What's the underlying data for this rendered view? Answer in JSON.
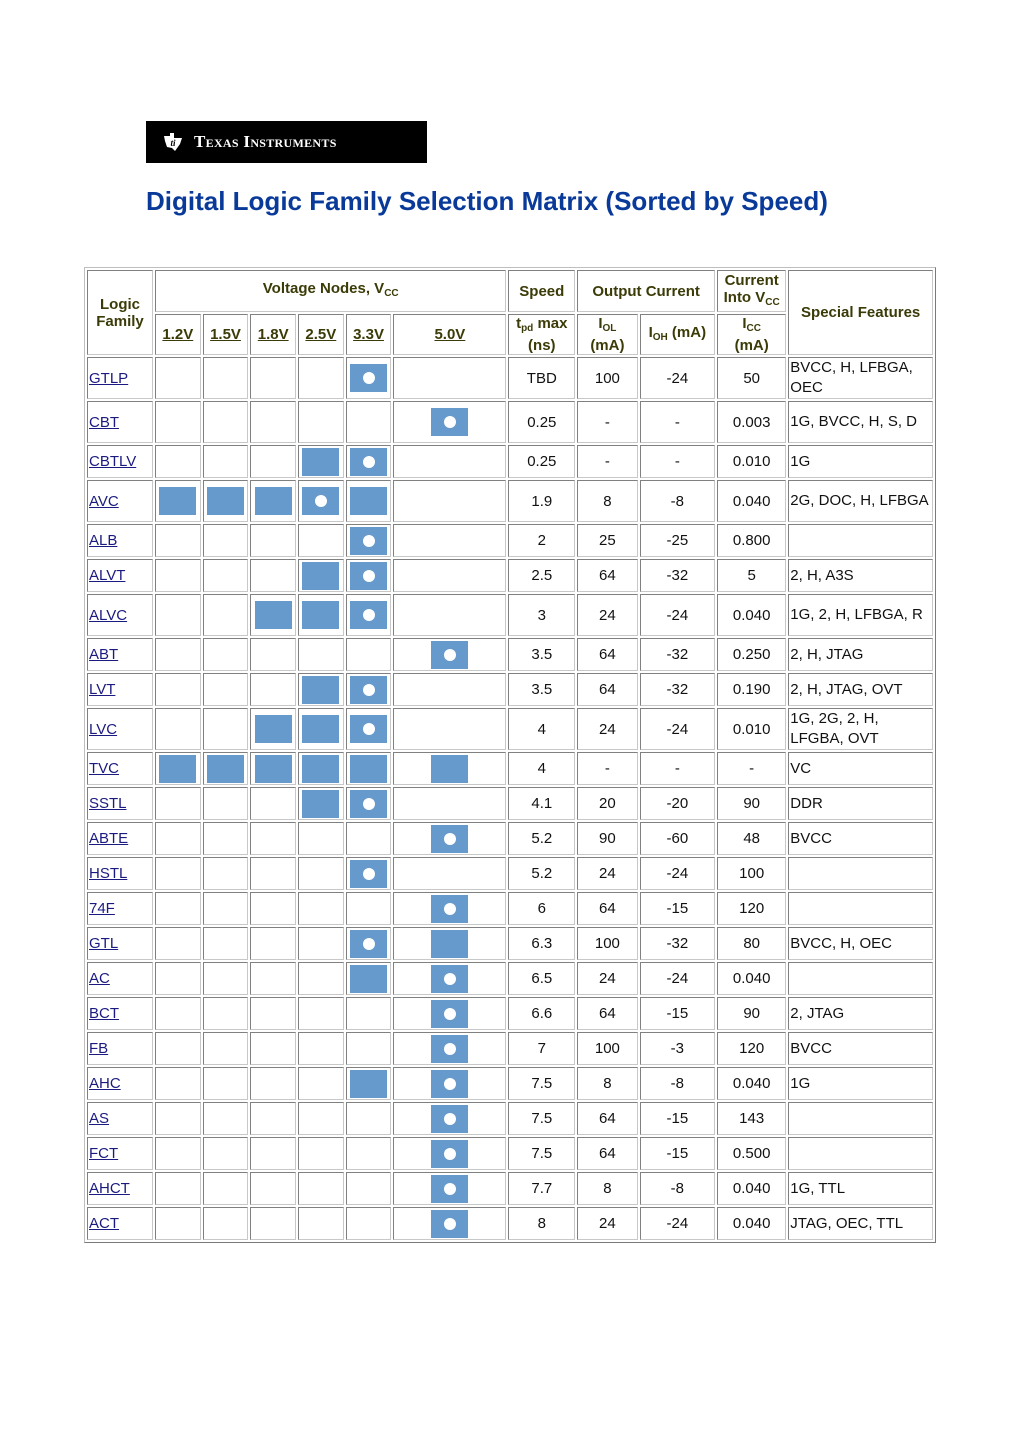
{
  "logo": {
    "brand": "Texas Instruments",
    "icon": "ti-state-logo-icon"
  },
  "page_title": "Digital Logic Family Selection Matrix (Sorted by Speed)",
  "table": {
    "headers": {
      "logic_family": "Logic Family",
      "voltage_nodes": "Voltage Nodes, V",
      "voltage_nodes_sub": "CC",
      "speed": "Speed",
      "output_current": "Output Current",
      "current_into": "Current Into V",
      "current_into_sub": "CC",
      "special_features": "Special Features",
      "voltages": [
        "1.2V",
        "1.5V",
        "1.8V",
        "2.5V",
        "3.3V",
        "5.0V"
      ],
      "tpd_main": "t",
      "tpd_sub": "pd",
      "tpd_rest": " max (ns)",
      "iol_main": "I",
      "iol_sub": "OL",
      "iol_rest": "(mA)",
      "ioh_main": "I",
      "ioh_sub": "OH",
      "ioh_rest": " (mA)",
      "icc_main": "I",
      "icc_sub": "CC",
      "icc_rest": "(mA)"
    },
    "legend": {
      "supported": "filled-blue-cell",
      "optimized": "blue-cell-with-white-dot",
      "color": "#6699cc"
    },
    "rows": [
      {
        "family": "GTLP",
        "v": [
          "",
          "",
          "",
          "",
          "opt",
          ""
        ],
        "tpd": "TBD",
        "iol": "100",
        "ioh": "-24",
        "icc": "50",
        "features": "BVCC, H, LFBGA, OEC",
        "tall": true
      },
      {
        "family": "CBT",
        "v": [
          "",
          "",
          "",
          "",
          "",
          "opt"
        ],
        "tpd": "0.25",
        "iol": "-",
        "ioh": "-",
        "icc": "0.003",
        "features": "1G, BVCC, H, S, D",
        "tall": true
      },
      {
        "family": "CBTLV",
        "v": [
          "",
          "",
          "",
          "sup",
          "opt",
          ""
        ],
        "tpd": "0.25",
        "iol": "-",
        "ioh": "-",
        "icc": "0.010",
        "features": "1G"
      },
      {
        "family": "AVC",
        "v": [
          "sup",
          "sup",
          "sup",
          "opt",
          "sup",
          ""
        ],
        "tpd": "1.9",
        "iol": "8",
        "ioh": "-8",
        "icc": "0.040",
        "features": "2G, DOC, H, LFBGA",
        "tall": true
      },
      {
        "family": "ALB",
        "v": [
          "",
          "",
          "",
          "",
          "opt",
          ""
        ],
        "tpd": "2",
        "iol": "25",
        "ioh": "-25",
        "icc": "0.800",
        "features": ""
      },
      {
        "family": "ALVT",
        "v": [
          "",
          "",
          "",
          "sup",
          "opt",
          ""
        ],
        "tpd": "2.5",
        "iol": "64",
        "ioh": "-32",
        "icc": "5",
        "features": "2, H, A3S"
      },
      {
        "family": "ALVC",
        "v": [
          "",
          "",
          "sup",
          "sup",
          "opt",
          ""
        ],
        "tpd": "3",
        "iol": "24",
        "ioh": "-24",
        "icc": "0.040",
        "features": "1G, 2, H, LFBGA, R",
        "tall": true
      },
      {
        "family": "ABT",
        "v": [
          "",
          "",
          "",
          "",
          "",
          "opt"
        ],
        "tpd": "3.5",
        "iol": "64",
        "ioh": "-32",
        "icc": "0.250",
        "features": "2, H, JTAG"
      },
      {
        "family": "LVT",
        "v": [
          "",
          "",
          "",
          "sup",
          "opt",
          ""
        ],
        "tpd": "3.5",
        "iol": "64",
        "ioh": "-32",
        "icc": "0.190",
        "features": "2, H, JTAG, OVT"
      },
      {
        "family": "LVC",
        "v": [
          "",
          "",
          "sup",
          "sup",
          "opt",
          ""
        ],
        "tpd": "4",
        "iol": "24",
        "ioh": "-24",
        "icc": "0.010",
        "features": "1G, 2G, 2, H, LFGBA, OVT",
        "tall": true
      },
      {
        "family": "TVC",
        "v": [
          "sup",
          "sup",
          "sup",
          "sup",
          "sup",
          "sup"
        ],
        "tpd": "4",
        "iol": "-",
        "ioh": "-",
        "icc": "-",
        "features": "VC"
      },
      {
        "family": "SSTL",
        "v": [
          "",
          "",
          "",
          "sup",
          "opt",
          ""
        ],
        "tpd": "4.1",
        "iol": "20",
        "ioh": "-20",
        "icc": "90",
        "features": "DDR"
      },
      {
        "family": "ABTE",
        "v": [
          "",
          "",
          "",
          "",
          "",
          "opt"
        ],
        "tpd": "5.2",
        "iol": "90",
        "ioh": "-60",
        "icc": "48",
        "features": "BVCC"
      },
      {
        "family": "HSTL",
        "v": [
          "",
          "",
          "",
          "",
          "opt",
          ""
        ],
        "tpd": "5.2",
        "iol": "24",
        "ioh": "-24",
        "icc": "100",
        "features": ""
      },
      {
        "family": "74F",
        "v": [
          "",
          "",
          "",
          "",
          "",
          "opt"
        ],
        "tpd": "6",
        "iol": "64",
        "ioh": "-15",
        "icc": "120",
        "features": ""
      },
      {
        "family": "GTL",
        "v": [
          "",
          "",
          "",
          "",
          "opt",
          "sup"
        ],
        "tpd": "6.3",
        "iol": "100",
        "ioh": "-32",
        "icc": "80",
        "features": "BVCC, H, OEC"
      },
      {
        "family": "AC",
        "v": [
          "",
          "",
          "",
          "",
          "sup",
          "opt"
        ],
        "tpd": "6.5",
        "iol": "24",
        "ioh": "-24",
        "icc": "0.040",
        "features": ""
      },
      {
        "family": "BCT",
        "v": [
          "",
          "",
          "",
          "",
          "",
          "opt"
        ],
        "tpd": "6.6",
        "iol": "64",
        "ioh": "-15",
        "icc": "90",
        "features": "2, JTAG"
      },
      {
        "family": "FB",
        "v": [
          "",
          "",
          "",
          "",
          "",
          "opt"
        ],
        "tpd": "7",
        "iol": "100",
        "ioh": "-3",
        "icc": "120",
        "features": "BVCC"
      },
      {
        "family": "AHC",
        "v": [
          "",
          "",
          "",
          "",
          "sup",
          "opt"
        ],
        "tpd": "7.5",
        "iol": "8",
        "ioh": "-8",
        "icc": "0.040",
        "features": "1G"
      },
      {
        "family": "AS",
        "v": [
          "",
          "",
          "",
          "",
          "",
          "opt"
        ],
        "tpd": "7.5",
        "iol": "64",
        "ioh": "-15",
        "icc": "143",
        "features": ""
      },
      {
        "family": "FCT",
        "v": [
          "",
          "",
          "",
          "",
          "",
          "opt"
        ],
        "tpd": "7.5",
        "iol": "64",
        "ioh": "-15",
        "icc": "0.500",
        "features": ""
      },
      {
        "family": "AHCT",
        "v": [
          "",
          "",
          "",
          "",
          "",
          "opt"
        ],
        "tpd": "7.7",
        "iol": "8",
        "ioh": "-8",
        "icc": "0.040",
        "features": "1G, TTL"
      },
      {
        "family": "ACT",
        "v": [
          "",
          "",
          "",
          "",
          "",
          "opt"
        ],
        "tpd": "8",
        "iol": "24",
        "ioh": "-24",
        "icc": "0.040",
        "features": "JTAG, OEC, TTL"
      }
    ]
  }
}
